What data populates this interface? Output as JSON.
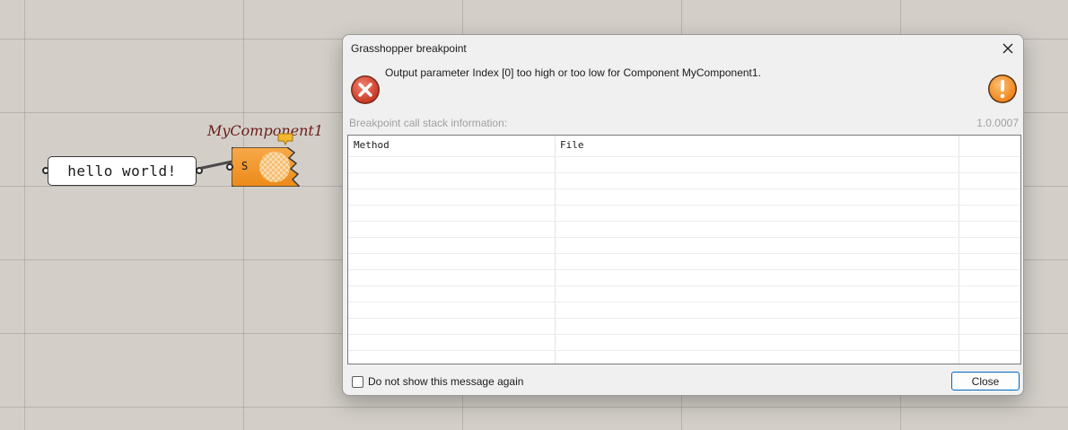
{
  "canvas": {
    "panel_text": "hello world!",
    "component_name": "MyComponent1",
    "component_input": "S"
  },
  "dialog": {
    "title": "Grasshopper breakpoint",
    "message": "Output parameter Index [0] too high or too low for Component MyComponent1.",
    "stack_label": "Breakpoint call stack information:",
    "version": "1.0.0007",
    "columns": [
      "Method",
      "File"
    ],
    "checkbox_label": "Do not show this message again",
    "checkbox_checked": false,
    "close_button": "Close"
  },
  "icons": {
    "error": "error-circle-icon",
    "warning": "warning-exclamation-icon",
    "close": "close-icon"
  },
  "colors": {
    "component_orange": "#f0901c",
    "error_red": "#d9412e",
    "warning_orange": "#f58a1f",
    "accent_blue": "#0067c0"
  }
}
